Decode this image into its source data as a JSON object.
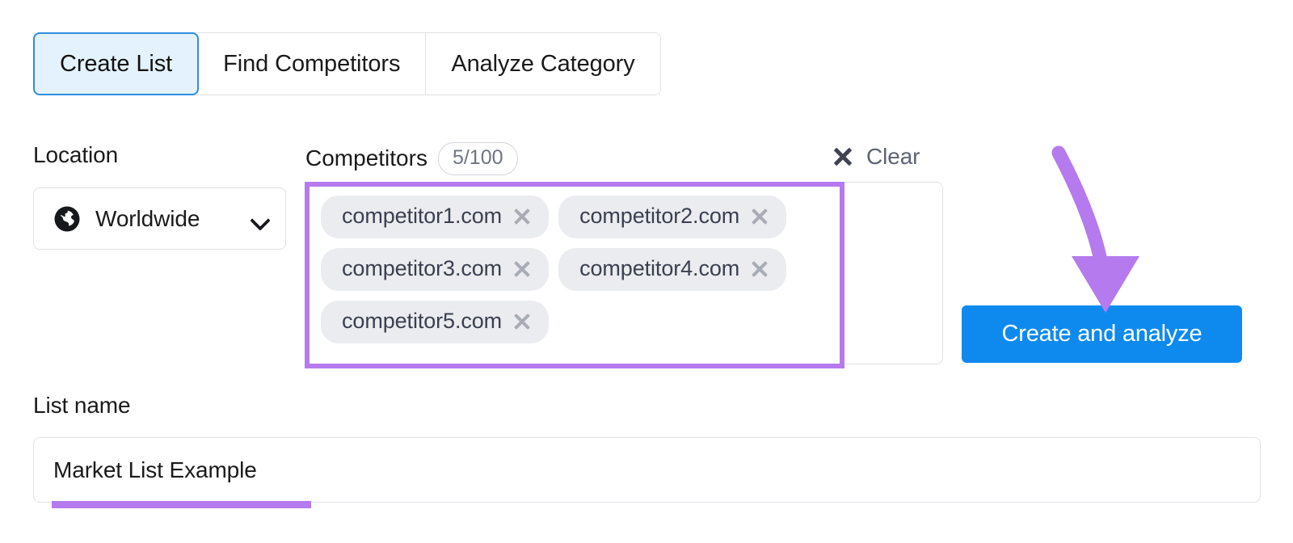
{
  "tabs": [
    {
      "label": "Create List",
      "active": true
    },
    {
      "label": "Find Competitors",
      "active": false
    },
    {
      "label": "Analyze Category",
      "active": false
    }
  ],
  "location": {
    "label": "Location",
    "selected": "Worldwide",
    "icon": "globe-icon",
    "chevron": "chevron-down-icon"
  },
  "competitors": {
    "label": "Competitors",
    "count_badge": "5/100",
    "clear_label": "Clear",
    "clear_icon": "close-icon",
    "chips": [
      {
        "label": "competitor1.com",
        "remove_icon": "close-icon"
      },
      {
        "label": "competitor2.com",
        "remove_icon": "close-icon"
      },
      {
        "label": "competitor3.com",
        "remove_icon": "close-icon"
      },
      {
        "label": "competitor4.com",
        "remove_icon": "close-icon"
      },
      {
        "label": "competitor5.com",
        "remove_icon": "close-icon"
      }
    ]
  },
  "list_name": {
    "label": "List name",
    "value": "Market List Example",
    "placeholder": "List name"
  },
  "primary_action": {
    "label": "Create and analyze"
  },
  "annotations": {
    "highlight_color": "#b57aed",
    "rectangle_target": "competitors-chips",
    "underline_target": "list-name-value",
    "arrow_target": "create-and-analyze-button"
  },
  "colors": {
    "accent_blue": "#0e8aef",
    "active_tab_bg": "#e3f2fd",
    "active_tab_border": "#2f8ee0",
    "chip_bg": "#ebecef",
    "border_gray": "#dfe1e6",
    "annotation_purple": "#b57aed"
  }
}
